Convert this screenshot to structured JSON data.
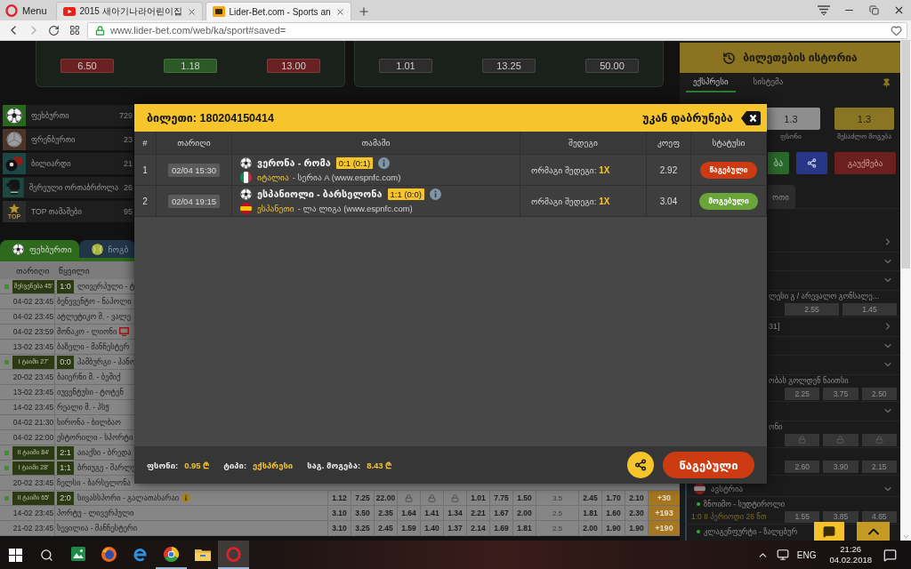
{
  "browser": {
    "menu_label": "Menu",
    "tabs": [
      {
        "kind": "video",
        "title": "2015 새아기나라어린이집",
        "selected": false
      },
      {
        "kind": "site",
        "title": "Lider-Bet.com - Sports an",
        "selected": true
      }
    ],
    "url": "www.lider-bet.com/web/ka/sport#saved="
  },
  "featured_matches": [
    {
      "odds": [
        {
          "value": "6.50",
          "color": "#6b2121"
        },
        {
          "value": "1.18",
          "color": "#2c5a26"
        },
        {
          "value": "13.00",
          "color": "#6b2121"
        }
      ]
    },
    {
      "odds": [
        {
          "value": "1.01",
          "color": "#2d2d2d"
        },
        {
          "value": "13.25",
          "color": "#2d2d2d"
        },
        {
          "value": "50.00",
          "color": "#2d2d2d"
        }
      ]
    }
  ],
  "sports": [
    {
      "kind": "football",
      "name": "ფეხბურთი",
      "count": "729"
    },
    {
      "kind": "volleyball",
      "name": "ფრენბურთი",
      "count": "23"
    },
    {
      "kind": "billiards",
      "name": "ბილიარდი",
      "count": "21"
    },
    {
      "kind": "mma",
      "name": "შერეული ორთაბრძოლა",
      "count": "26"
    },
    {
      "kind": "top",
      "badge": "TOP",
      "name": "TOP თამაშები",
      "count": "95"
    }
  ],
  "sport_tabs": [
    {
      "kind": "football",
      "label": "ფეხბურთი",
      "selected": true
    },
    {
      "kind": "tennis",
      "label": "ჩოგბ",
      "selected": false
    }
  ],
  "events": {
    "columns": [
      "თარიღი",
      "წყვილი"
    ],
    "rows": [
      {
        "live": true,
        "time": "შესვენება 45'",
        "score": "1:0",
        "teams": "ლივერპული - ტ"
      },
      {
        "live": false,
        "time": "04-02 23:45",
        "teams": "ბენევენტო - ნაპოლი"
      },
      {
        "live": false,
        "time": "04-02 23:45",
        "teams": "ატლეტიკო მ. - ვალე"
      },
      {
        "live": false,
        "time": "04-02 23:59",
        "teams": "მონაკო - ლიონი",
        "info": false,
        "tv": true
      },
      {
        "live": false,
        "time": "13-02 23:45",
        "teams": "ბაზელი - მანჩესტერ"
      },
      {
        "live": true,
        "time": "I ტაიმი 27'",
        "score": "0:0",
        "teams": "ჰამბურგი - ჰანო"
      },
      {
        "live": false,
        "time": "20-02 23:45",
        "teams": "ბაიერნი მ. - ბეშიქ"
      },
      {
        "live": false,
        "time": "13-02 23:45",
        "teams": "იუვენტუსი - ტოტენ"
      },
      {
        "live": false,
        "time": "14-02 23:45",
        "teams": "რეალი მ. - პსჟ",
        "info": false,
        "tv": false
      },
      {
        "live": false,
        "time": "04-02 21:30",
        "teams": "ხირონა - ბილბაო",
        "info": false,
        "tv": false
      },
      {
        "live": false,
        "time": "04-02 22:00",
        "teams": "ესტორილი - სპორტი"
      },
      {
        "live": true,
        "time": "II ტაიმი 84'",
        "score": "2:1",
        "teams": "აიაქსი - ბრედა"
      },
      {
        "live": true,
        "time": "I ტაიმი 28'",
        "score": "1:1",
        "teams": "ბრიუგე - შარლე"
      },
      {
        "live": false,
        "time": "20-02 23:45",
        "teams": "ჩელსი - ბარსელონა"
      },
      {
        "live": true,
        "time": "II ტაიმი 65'",
        "score": "2:0",
        "teams": "სივასსპორი - გალათასარაი",
        "info": true,
        "tv": false,
        "markets": [
          {
            "kind": "odd",
            "value": "1.12"
          },
          {
            "kind": "odd",
            "value": "7.25"
          },
          {
            "kind": "odd",
            "value": "22.00"
          },
          {
            "kind": "lock"
          },
          {
            "kind": "lock"
          },
          {
            "kind": "lock"
          },
          {
            "kind": "odd",
            "value": "1.01"
          },
          {
            "kind": "odd",
            "value": "7.75"
          },
          {
            "kind": "odd",
            "value": "1.50"
          },
          {
            "kind": "line",
            "value": "3.5"
          },
          {
            "kind": "odd",
            "value": "2.45"
          },
          {
            "kind": "odd",
            "value": "1.70"
          },
          {
            "kind": "odd",
            "value": "2.10"
          }
        ],
        "more": "+30"
      },
      {
        "live": false,
        "time": "14-02 23:45",
        "teams": "პორტუ - ლივერპული",
        "info": false,
        "tv": false,
        "markets": [
          {
            "kind": "odd",
            "value": "3.10"
          },
          {
            "kind": "odd",
            "value": "3.50"
          },
          {
            "kind": "odd",
            "value": "2.35"
          },
          {
            "kind": "odd",
            "value": "1.64"
          },
          {
            "kind": "odd",
            "value": "1.41"
          },
          {
            "kind": "odd",
            "value": "1.34"
          },
          {
            "kind": "odd",
            "value": "2.21"
          },
          {
            "kind": "odd",
            "value": "1.67"
          },
          {
            "kind": "odd",
            "value": "2.00"
          },
          {
            "kind": "line",
            "value": "2.5"
          },
          {
            "kind": "odd",
            "value": "1.81"
          },
          {
            "kind": "odd",
            "value": "1.60"
          },
          {
            "kind": "odd",
            "value": "2.30"
          }
        ],
        "more": "+193"
      },
      {
        "live": false,
        "time": "21-02 23:45",
        "teams": "სევილია - მანჩესტერი",
        "info": false,
        "tv": false,
        "markets": [
          {
            "kind": "odd",
            "value": "3.10"
          },
          {
            "kind": "odd",
            "value": "3.25"
          },
          {
            "kind": "odd",
            "value": "2.45"
          },
          {
            "kind": "odd",
            "value": "1.59"
          },
          {
            "kind": "odd",
            "value": "1.40"
          },
          {
            "kind": "odd",
            "value": "1.37"
          },
          {
            "kind": "odd",
            "value": "2.14"
          },
          {
            "kind": "odd",
            "value": "1.69"
          },
          {
            "kind": "odd",
            "value": "1.81"
          },
          {
            "kind": "line",
            "value": "2.5"
          },
          {
            "kind": "odd",
            "value": "2.00"
          },
          {
            "kind": "odd",
            "value": "1.90"
          },
          {
            "kind": "odd",
            "value": "1.90"
          }
        ],
        "more": "+190"
      }
    ]
  },
  "bet_slip": {
    "history_button": "ბილეთების ისტორია",
    "tabs": [
      {
        "label": "ექსპრესი",
        "selected": true
      },
      {
        "label": "სისტემა",
        "selected": false
      }
    ],
    "stake": {
      "value": "1.3",
      "label": "ფსონი"
    },
    "potential_win": {
      "value": "1.3",
      "label": "შესაძლო მოგება"
    },
    "actions": [
      {
        "kind": "place",
        "label": "ბა"
      },
      {
        "kind": "share"
      },
      {
        "kind": "cancel",
        "label": "გაუქმება"
      }
    ],
    "list_tabs": [
      {
        "label": "ოთი",
        "selected": true
      }
    ],
    "list": [
      {
        "kind": "group",
        "expanded": false
      },
      {
        "kind": "group",
        "expanded": true
      },
      {
        "kind": "group",
        "expanded": true
      },
      {
        "kind": "match",
        "title": "ლესი გ / არევალო გონსალე...",
        "odds": [
          {
            "kind": "odd",
            "value": "2.55"
          },
          {
            "kind": "odd",
            "value": "1.45"
          }
        ]
      },
      {
        "kind": "group",
        "label": "31]",
        "expanded": false
      },
      {
        "kind": "group",
        "expanded": true
      },
      {
        "kind": "group",
        "expanded": true
      },
      {
        "kind": "match",
        "title": "ობას გოლდენ ნაითსი",
        "odds": [
          {
            "kind": "odd",
            "value": "2.25"
          },
          {
            "kind": "odd",
            "value": "3.75"
          },
          {
            "kind": "odd",
            "value": "2.50"
          }
        ]
      },
      {
        "kind": "group",
        "expanded": true
      },
      {
        "kind": "match",
        "title": "ონი",
        "odds": [
          {
            "kind": "lock"
          },
          {
            "kind": "lock"
          },
          {
            "kind": "lock"
          }
        ]
      },
      {
        "kind": "match",
        "odds": [
          {
            "kind": "odd",
            "value": "2.60"
          },
          {
            "kind": "odd",
            "value": "3.90"
          },
          {
            "kind": "odd",
            "value": "2.15"
          }
        ]
      },
      {
        "kind": "country",
        "label": "ავსტრია",
        "expanded": true,
        "flag": {
          "kind": "austria"
        }
      },
      {
        "kind": "live_match",
        "title": "ზნოიმო - სუდტიროლი",
        "status": "1:0 II პერიოდი 26 წთ",
        "odds": [
          {
            "kind": "odd",
            "value": "1.55"
          },
          {
            "kind": "odd",
            "value": "3.85"
          },
          {
            "kind": "odd",
            "value": "4.65"
          }
        ]
      },
      {
        "kind": "live_match",
        "title": "კლაგენფურტი - ზალცბურ"
      }
    ]
  },
  "ticket": {
    "title": "ბილეთი: 180204150414",
    "back_label": "უკან დაბრუნება",
    "columns": [
      "#",
      "თარიღი",
      "თამაში",
      "შედეგი",
      "კოეფ",
      "სტატუსი"
    ],
    "rows": [
      {
        "number": "1",
        "date": "02/04 15:30",
        "match": "ვერონა - რომა",
        "score": "0:1 (0:1)",
        "flag": {
          "kind": "italy"
        },
        "country": "იტალია",
        "league": "- სერია A (www.espnfc.com)",
        "market": "ორმაგი შედეგი:",
        "pick": "1X",
        "odds": "2.92",
        "status": {
          "kind": "lost",
          "label": "წაგებული"
        }
      },
      {
        "number": "2",
        "date": "02/04 19:15",
        "match": "ესპანიოლი - ბარსელონა",
        "score": "1:1 (0:0)",
        "flag": {
          "kind": "spain"
        },
        "country": "ესპანეთი",
        "league": "- ლა ლიგა (www.espnfc.com)",
        "market": "ორმაგი შედეგი:",
        "pick": "1X",
        "odds": "3.04",
        "status": {
          "kind": "won",
          "label": "მოგებული"
        }
      }
    ],
    "summary": {
      "stake_label": "ფსონი:",
      "stake": "0.95 ₾",
      "type_label": "ტიპი:",
      "type": "ექსპრესი",
      "win_label": "საგ. მოგება:",
      "win": "8.43 ₾",
      "status": {
        "kind": "lost",
        "label": "წაგებული"
      }
    }
  },
  "taskbar": {
    "apps": [
      {
        "kind": "picture",
        "selected": false,
        "running": false
      },
      {
        "kind": "globe",
        "selected": false,
        "running": false
      },
      {
        "kind": "letter-e",
        "selected": false,
        "running": false
      },
      {
        "kind": "segmented-ring",
        "selected": false,
        "running": true
      },
      {
        "kind": "folder",
        "selected": false,
        "running": false
      },
      {
        "kind": "o-ring",
        "selected": true,
        "running": true
      }
    ],
    "language": "ENG",
    "time": "21:26",
    "date": "04.02.2018"
  }
}
